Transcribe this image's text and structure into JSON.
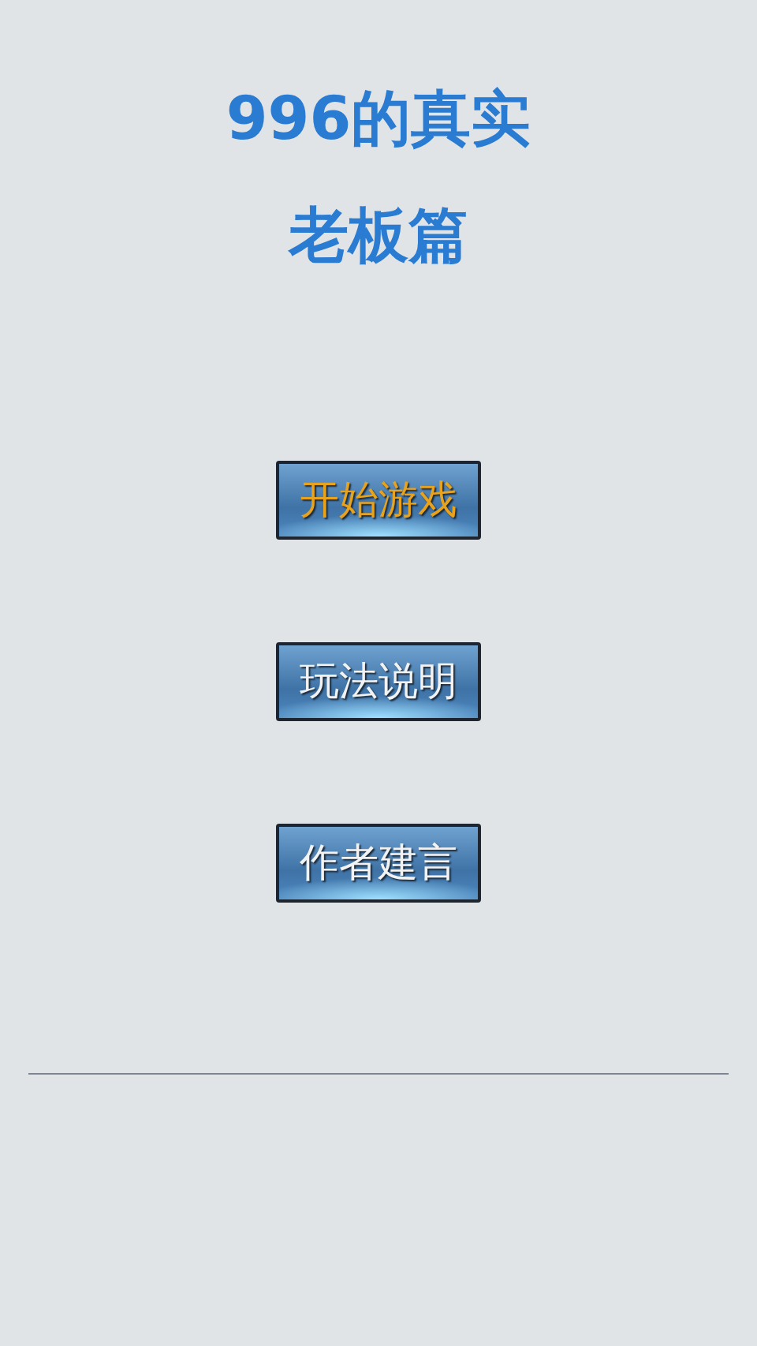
{
  "title_lines": [
    "996的真实",
    "老板篇"
  ],
  "menu_buttons": [
    {
      "label": "开始游戏",
      "selected": true
    },
    {
      "label": "玩法说明",
      "selected": false
    },
    {
      "label": "作者建言",
      "selected": false
    }
  ]
}
